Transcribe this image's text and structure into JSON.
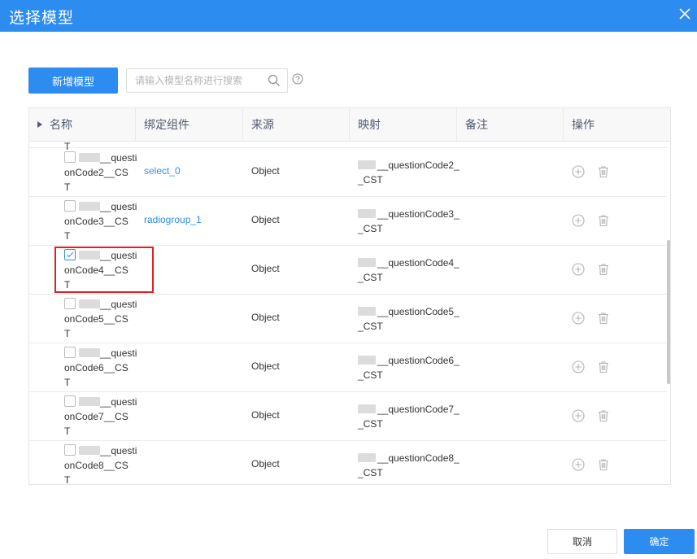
{
  "dialog": {
    "title": "选择模型",
    "close_icon": "close-icon"
  },
  "toolbar": {
    "add_label": "新增模型",
    "search_placeholder": "请输入模型名称进行搜索",
    "search_icon": "search-icon",
    "help_icon": "help-icon"
  },
  "table": {
    "columns": [
      "名称",
      "绑定组件",
      "来源",
      "映射",
      "备注",
      "操作"
    ],
    "top_cut_text": "T",
    "rows": [
      {
        "name_a": "__questi",
        "name_b": "onCode2__CS",
        "name_c": "T",
        "component": "select_0",
        "source": "Object",
        "map_a": "__questionCode2_",
        "map_b": "_CST",
        "remark": "",
        "checked": false
      },
      {
        "name_a": "__questi",
        "name_b": "onCode3__CS",
        "name_c": "T",
        "component": "radiogroup_1",
        "source": "Object",
        "map_a": "__questionCode3_",
        "map_b": "_CST",
        "remark": "",
        "checked": false
      },
      {
        "name_a": "__questi",
        "name_b": "onCode4__CS",
        "name_c": "T",
        "component": "",
        "source": "Object",
        "map_a": "__questionCode4_",
        "map_b": "_CST",
        "remark": "",
        "checked": true
      },
      {
        "name_a": "__questi",
        "name_b": "onCode5__CS",
        "name_c": "T",
        "component": "",
        "source": "Object",
        "map_a": "__questionCode5_",
        "map_b": "_CST",
        "remark": "",
        "checked": false
      },
      {
        "name_a": "__questi",
        "name_b": "onCode6__CS",
        "name_c": "T",
        "component": "",
        "source": "Object",
        "map_a": "__questionCode6_",
        "map_b": "_CST",
        "remark": "",
        "checked": false
      },
      {
        "name_a": "__questi",
        "name_b": "onCode7__CS",
        "name_c": "T",
        "component": "",
        "source": "Object",
        "map_a": "__questionCode7_",
        "map_b": "_CST",
        "remark": "",
        "checked": false
      },
      {
        "name_a": "__questi",
        "name_b": "onCode8__CS",
        "name_c": "T",
        "component": "",
        "source": "Object",
        "map_a": "__questionCode8_",
        "map_b": "_CST",
        "remark": "",
        "checked": false
      }
    ]
  },
  "footer": {
    "cancel_label": "取消",
    "ok_label": "确定"
  },
  "colors": {
    "primary": "#2d8cf0",
    "highlight": "#e02020"
  }
}
